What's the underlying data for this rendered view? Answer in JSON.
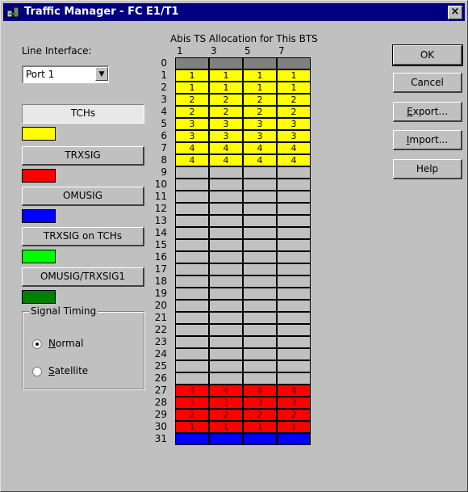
{
  "window": {
    "title": "Traffic Manager - FC E1/T1",
    "close_label": "×"
  },
  "line_interface": {
    "label": "Line Interface:",
    "value": "Port 1"
  },
  "signal_buttons": [
    {
      "label": "TCHs",
      "color": "#ffff00",
      "pressed": true
    },
    {
      "label": "TRXSIG",
      "color": "#ff0000",
      "pressed": false
    },
    {
      "label": "OMUSIG",
      "color": "#0000ff",
      "pressed": false
    },
    {
      "label": "TRXSIG on TCHs",
      "color": "#00ff00",
      "pressed": false
    },
    {
      "label": "OMUSIG/TRXSIG1",
      "color": "#008000",
      "pressed": false
    }
  ],
  "signal_timing": {
    "title": "Signal Timing",
    "options": [
      {
        "label": "Normal",
        "accel": "N",
        "rest": "ormal",
        "selected": true
      },
      {
        "label": "Satellite",
        "accel": "S",
        "rest": "atellite",
        "selected": false
      }
    ]
  },
  "allocation": {
    "title": "Abis TS Allocation for This BTS",
    "column_numbers": [
      "1",
      "3",
      "5",
      "7"
    ],
    "colors": {
      "gray": "#808080",
      "yellow": "#ffff00",
      "red": "#ff0000",
      "blue": "#0000ff",
      "empty": "#c0c0c0"
    },
    "rows": [
      {
        "ts": "0",
        "color": "gray",
        "cells": [
          "",
          "",
          "",
          ""
        ]
      },
      {
        "ts": "1",
        "color": "yellow",
        "cells": [
          "1",
          "1",
          "1",
          "1"
        ]
      },
      {
        "ts": "2",
        "color": "yellow",
        "cells": [
          "1",
          "1",
          "1",
          "1"
        ]
      },
      {
        "ts": "3",
        "color": "yellow",
        "cells": [
          "2",
          "2",
          "2",
          "2"
        ]
      },
      {
        "ts": "4",
        "color": "yellow",
        "cells": [
          "2",
          "2",
          "2",
          "2"
        ]
      },
      {
        "ts": "5",
        "color": "yellow",
        "cells": [
          "3",
          "3",
          "3",
          "3"
        ]
      },
      {
        "ts": "6",
        "color": "yellow",
        "cells": [
          "3",
          "3",
          "3",
          "3"
        ]
      },
      {
        "ts": "7",
        "color": "yellow",
        "cells": [
          "4",
          "4",
          "4",
          "4"
        ]
      },
      {
        "ts": "8",
        "color": "yellow",
        "cells": [
          "4",
          "4",
          "4",
          "4"
        ]
      },
      {
        "ts": "9",
        "color": "empty",
        "cells": [
          "",
          "",
          "",
          ""
        ]
      },
      {
        "ts": "10",
        "color": "empty",
        "cells": [
          "",
          "",
          "",
          ""
        ]
      },
      {
        "ts": "11",
        "color": "empty",
        "cells": [
          "",
          "",
          "",
          ""
        ]
      },
      {
        "ts": "12",
        "color": "empty",
        "cells": [
          "",
          "",
          "",
          ""
        ]
      },
      {
        "ts": "13",
        "color": "empty",
        "cells": [
          "",
          "",
          "",
          ""
        ]
      },
      {
        "ts": "14",
        "color": "empty",
        "cells": [
          "",
          "",
          "",
          ""
        ]
      },
      {
        "ts": "15",
        "color": "empty",
        "cells": [
          "",
          "",
          "",
          ""
        ]
      },
      {
        "ts": "16",
        "color": "empty",
        "cells": [
          "",
          "",
          "",
          ""
        ]
      },
      {
        "ts": "17",
        "color": "empty",
        "cells": [
          "",
          "",
          "",
          ""
        ]
      },
      {
        "ts": "18",
        "color": "empty",
        "cells": [
          "",
          "",
          "",
          ""
        ]
      },
      {
        "ts": "19",
        "color": "empty",
        "cells": [
          "",
          "",
          "",
          ""
        ]
      },
      {
        "ts": "20",
        "color": "empty",
        "cells": [
          "",
          "",
          "",
          ""
        ]
      },
      {
        "ts": "21",
        "color": "empty",
        "cells": [
          "",
          "",
          "",
          ""
        ]
      },
      {
        "ts": "22",
        "color": "empty",
        "cells": [
          "",
          "",
          "",
          ""
        ]
      },
      {
        "ts": "23",
        "color": "empty",
        "cells": [
          "",
          "",
          "",
          ""
        ]
      },
      {
        "ts": "24",
        "color": "empty",
        "cells": [
          "",
          "",
          "",
          ""
        ]
      },
      {
        "ts": "25",
        "color": "empty",
        "cells": [
          "",
          "",
          "",
          ""
        ]
      },
      {
        "ts": "26",
        "color": "empty",
        "cells": [
          "",
          "",
          "",
          ""
        ]
      },
      {
        "ts": "27",
        "color": "red",
        "cells": [
          "4",
          "4",
          "4",
          "4"
        ]
      },
      {
        "ts": "28",
        "color": "red",
        "cells": [
          "3",
          "3",
          "3",
          "3"
        ]
      },
      {
        "ts": "29",
        "color": "red",
        "cells": [
          "2",
          "2",
          "2",
          "2"
        ]
      },
      {
        "ts": "30",
        "color": "red",
        "cells": [
          "1",
          "1",
          "1",
          "1"
        ]
      },
      {
        "ts": "31",
        "color": "blue",
        "cells": [
          "",
          "",
          "",
          ""
        ]
      }
    ]
  },
  "actions": [
    {
      "label": "OK",
      "accel": "",
      "rest": "OK",
      "default": true
    },
    {
      "label": "Cancel",
      "accel": "",
      "rest": "Cancel",
      "default": false
    },
    {
      "label": "Export...",
      "accel": "E",
      "rest": "xport...",
      "default": false
    },
    {
      "label": "Import...",
      "accel": "I",
      "rest": "mport...",
      "default": false
    },
    {
      "label": "Help",
      "accel": "",
      "rest": "Help",
      "default": false
    }
  ]
}
